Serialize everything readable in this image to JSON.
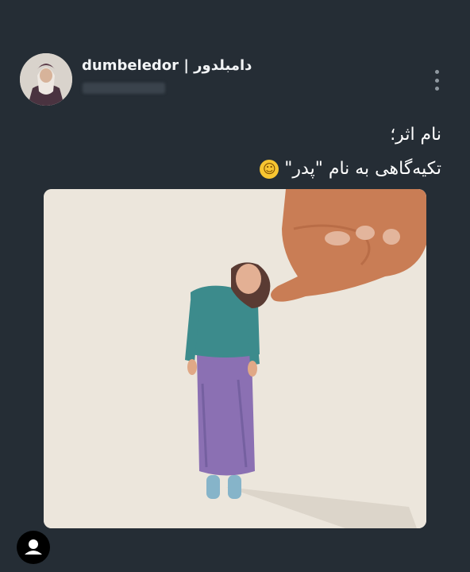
{
  "post": {
    "username": "dumbeledor | دامبلدور",
    "caption_line1": "نام اثر؛",
    "caption_line2": "تکیه‌گاهی به نام \"پدر\"",
    "emoji": "🙂"
  },
  "icons": {
    "more": "more-vertical-icon",
    "profile": "user-icon"
  }
}
